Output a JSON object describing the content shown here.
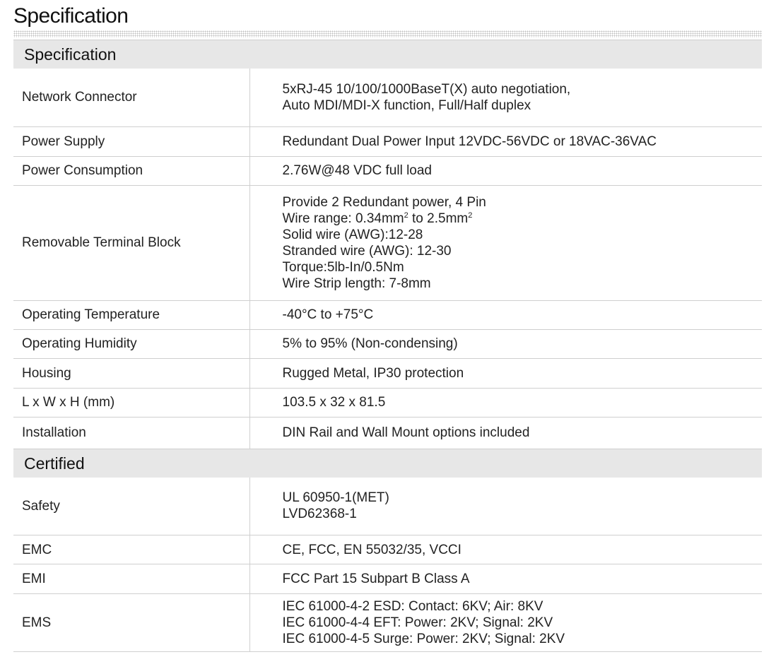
{
  "page": {
    "title": "Specification"
  },
  "sections": [
    {
      "title": "Specification",
      "rows": [
        {
          "label": "Network Connector",
          "h": 82,
          "lines": [
            [
              "5xRJ-45 10/100/1000BaseT(X) auto negotiation,"
            ],
            [
              "Auto MDI/MDI-X function, Full/Half duplex"
            ]
          ]
        },
        {
          "label": "Power Supply",
          "h": 42,
          "lines": [
            [
              "Redundant Dual Power Input 12VDC-56VDC or 18VAC-36VAC"
            ]
          ]
        },
        {
          "label": "Power Consumption",
          "h": 41,
          "lines": [
            [
              "2.76W@48 VDC full load"
            ]
          ]
        },
        {
          "label": "Removable Terminal Block",
          "h": 163,
          "lines": [
            [
              "Provide 2 Redundant power, 4 Pin"
            ],
            [
              "Wire range: 0.34mm",
              "2",
              " to 2.5mm",
              "2"
            ],
            [
              "Solid wire (AWG):12-28"
            ],
            [
              "Stranded wire (AWG): 12-30"
            ],
            [
              "Torque:5lb-In/0.5Nm"
            ],
            [
              "Wire Strip length: 7-8mm"
            ]
          ]
        },
        {
          "label": "Operating Temperature",
          "h": 41,
          "lines": [
            [
              "-40°C to +75°C"
            ]
          ]
        },
        {
          "label": "Operating Humidity",
          "h": 41,
          "lines": [
            [
              "5% to 95% (Non-condensing)"
            ]
          ]
        },
        {
          "label": "Housing",
          "h": 42,
          "lines": [
            [
              "Rugged Metal, IP30 protection"
            ]
          ]
        },
        {
          "label": "L x W x H (mm)",
          "h": 41,
          "lines": [
            [
              "103.5 x 32 x 81.5"
            ]
          ]
        },
        {
          "label": "Installation",
          "h": 45,
          "lines": [
            [
              "DIN Rail and Wall Mount options included"
            ]
          ]
        }
      ]
    },
    {
      "title": "Certified",
      "rows": [
        {
          "label": "Safety",
          "h": 82,
          "lines": [
            [
              "UL 60950-1(MET)"
            ],
            [
              "LVD62368-1"
            ]
          ]
        },
        {
          "label": "EMC",
          "h": 41,
          "lines": [
            [
              "CE, FCC, EN 55032/35, VCCI"
            ]
          ]
        },
        {
          "label": "EMI",
          "h": 42,
          "lines": [
            [
              "FCC Part 15 Subpart B Class A"
            ]
          ]
        },
        {
          "label": "EMS",
          "h": 82,
          "lines": [
            [
              "IEC 61000-4-2 ESD: Contact: 6KV; Air: 8KV"
            ],
            [
              "IEC 61000-4-4 EFT: Power: 2KV; Signal: 2KV"
            ],
            [
              "IEC 61000-4-5 Surge: Power: 2KV; Signal: 2KV"
            ]
          ]
        }
      ]
    }
  ]
}
